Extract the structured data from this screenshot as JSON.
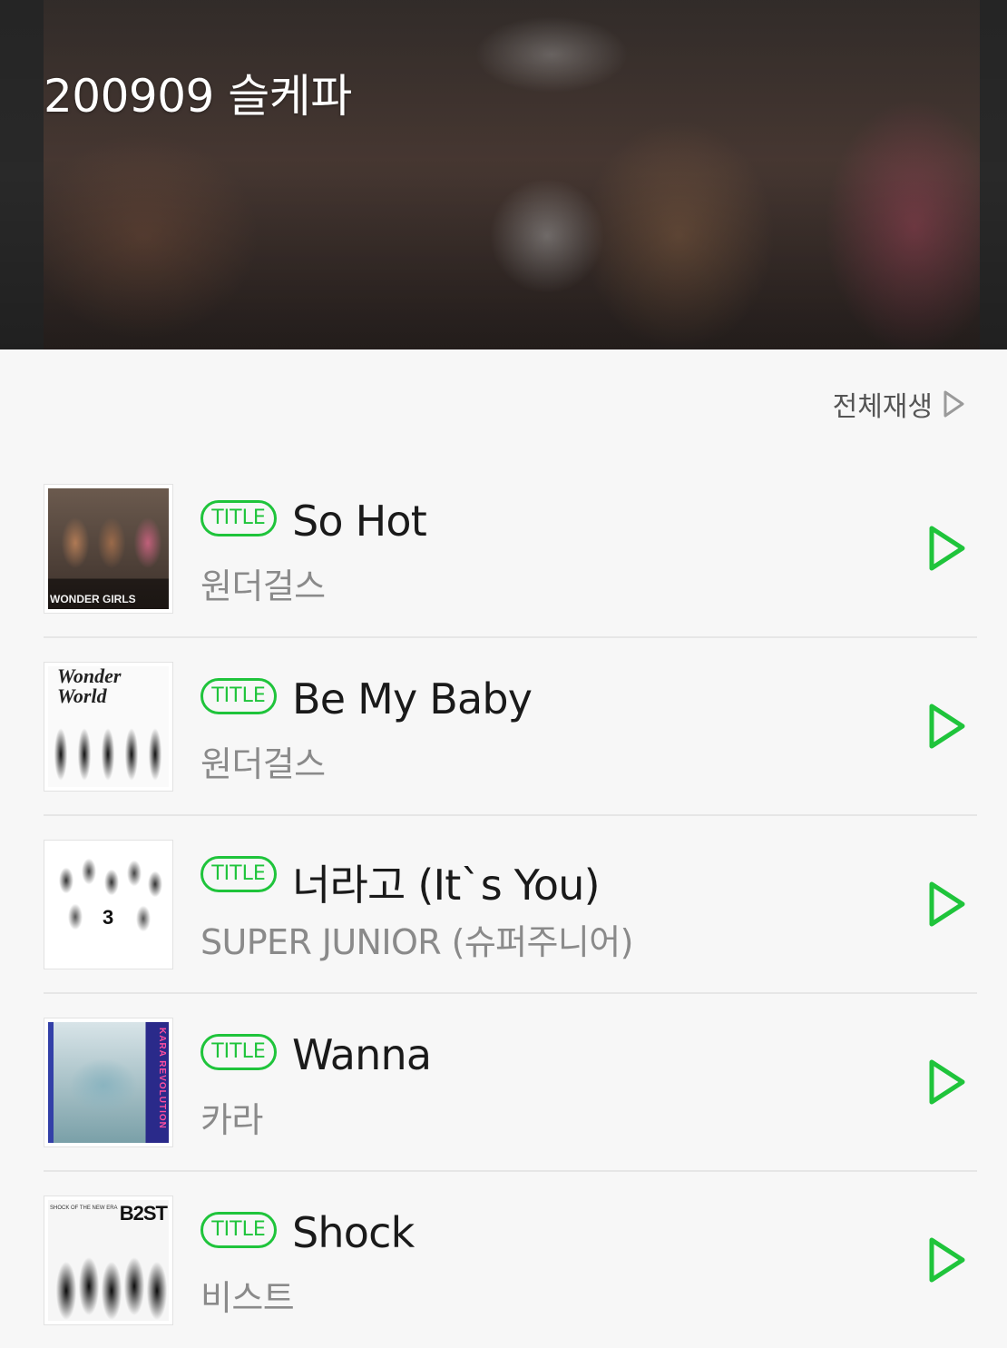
{
  "header": {
    "title": "200909 슬케파"
  },
  "play_all": {
    "label": "전체재생"
  },
  "accent_color": "#1fc43b",
  "badge_label": "TITLE",
  "songs": [
    {
      "title": "So Hot",
      "artist": "원더걸스",
      "cover_text": "WONDER GIRLS"
    },
    {
      "title": "Be My Baby",
      "artist": "원더걸스",
      "cover_text": "Wonder World"
    },
    {
      "title": "너라고 (It`s You)",
      "artist": "SUPER JUNIOR (슈퍼주니어)",
      "cover_text": "3"
    },
    {
      "title": "Wanna",
      "artist": "카라",
      "cover_text": "KARA REVOLUTION"
    },
    {
      "title": "Shock",
      "artist": "비스트",
      "cover_text": "B2ST",
      "cover_subtext": "SHOCK OF THE NEW ERA"
    }
  ],
  "icons": {
    "play_all": "play-outline-icon",
    "row_play": "play-outline-icon"
  }
}
